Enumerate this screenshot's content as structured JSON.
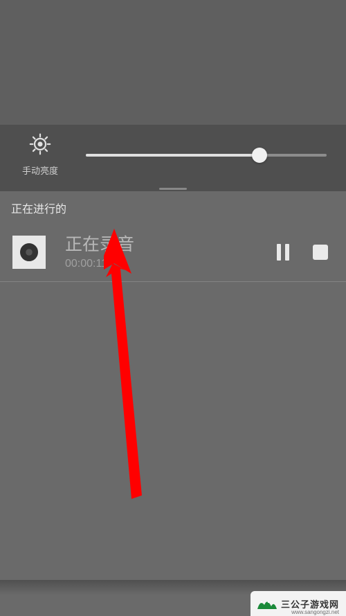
{
  "brightness": {
    "label": "手动亮度",
    "value_percent": 72
  },
  "ongoing": {
    "header": "正在进行的"
  },
  "notification": {
    "title": "正在录音",
    "timer": "00:00:11"
  },
  "watermark": {
    "brand": "三公子游戏网",
    "url": "www.sangongzi.net"
  },
  "colors": {
    "accent_arrow": "#ff0000",
    "wm_logo": "#1b8a3a"
  }
}
